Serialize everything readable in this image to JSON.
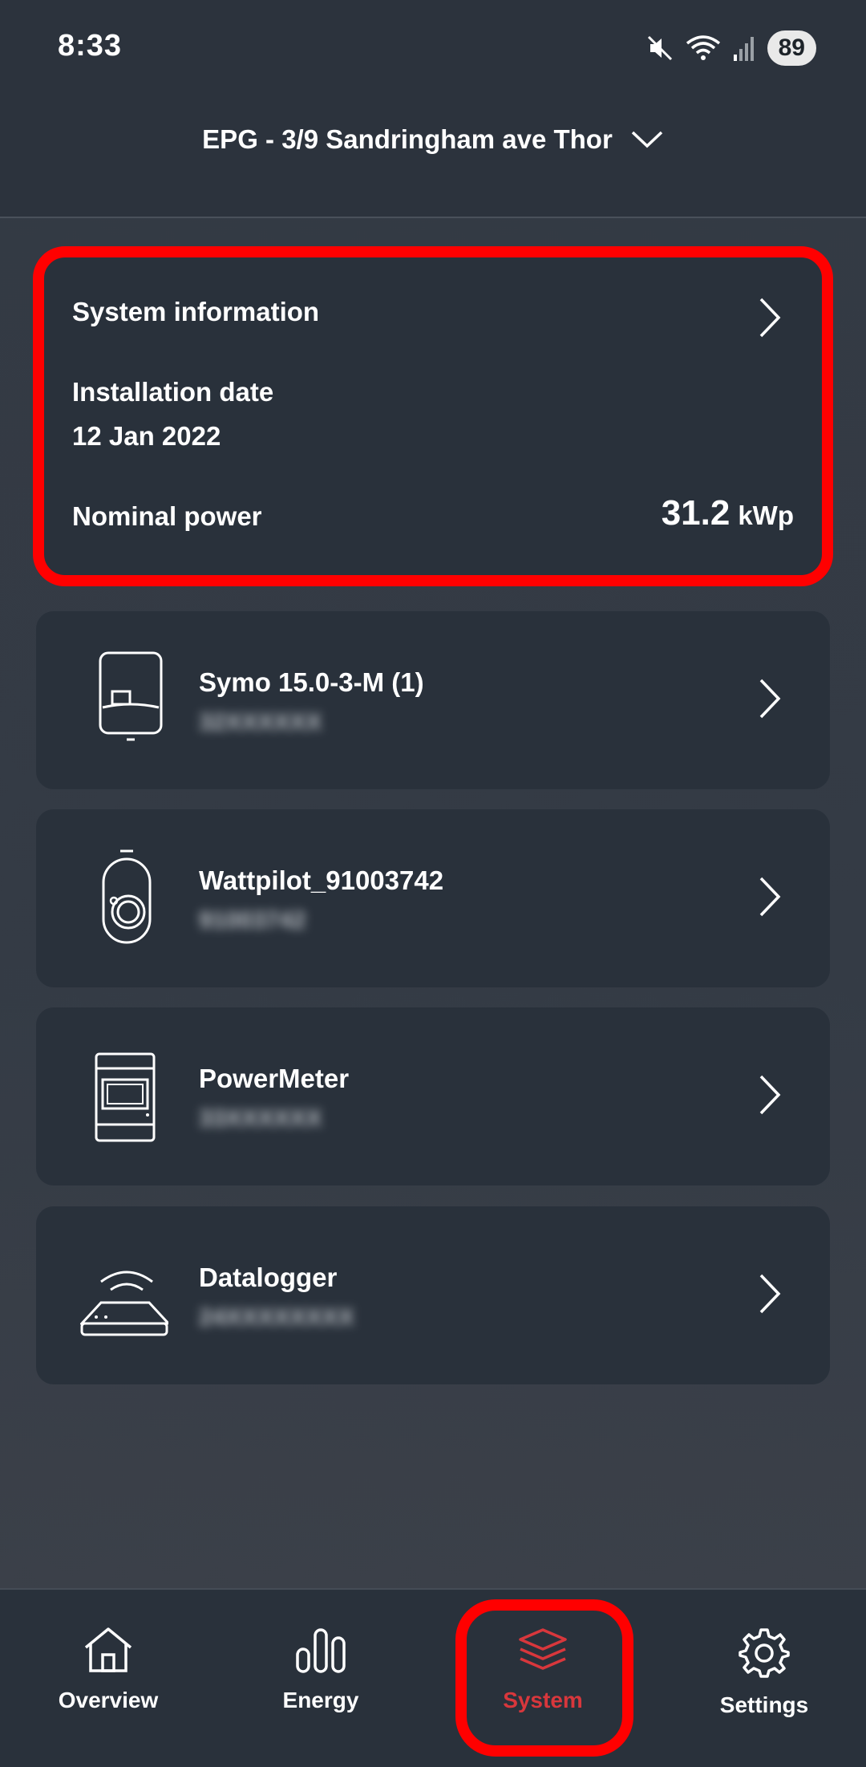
{
  "status_bar": {
    "time": "8:33",
    "battery": "89",
    "icons": [
      "mute-icon",
      "wifi-icon",
      "signal-icon",
      "battery-icon"
    ]
  },
  "header": {
    "site_name": "EPG - 3/9 Sandringham ave Thor"
  },
  "system_info": {
    "title": "System information",
    "installation_label": "Installation date",
    "installation_date": "12 Jan 2022",
    "nominal_label": "Nominal power",
    "nominal_value": "31.2",
    "nominal_unit": "kWp"
  },
  "devices": [
    {
      "name": "Symo 15.0-3-M (1)",
      "serial": "32XXXXXX",
      "icon": "inverter-icon"
    },
    {
      "name": "Wattpilot_91003742",
      "serial": "91003742",
      "icon": "wallbox-icon"
    },
    {
      "name": "PowerMeter",
      "serial": "33XXXXXX",
      "icon": "power-meter-icon"
    },
    {
      "name": "Datalogger",
      "serial": "24XXXXXXXX",
      "icon": "router-icon"
    }
  ],
  "nav": [
    {
      "label": "Overview",
      "icon": "home-icon",
      "active": false
    },
    {
      "label": "Energy",
      "icon": "bar-chart-icon",
      "active": false
    },
    {
      "label": "System",
      "icon": "layers-icon",
      "active": true
    },
    {
      "label": "Settings",
      "icon": "gear-icon",
      "active": false
    }
  ],
  "colors": {
    "accent": "#d8373c",
    "highlight": "#ff0000",
    "card": "#29313b",
    "background": "#333a44"
  }
}
